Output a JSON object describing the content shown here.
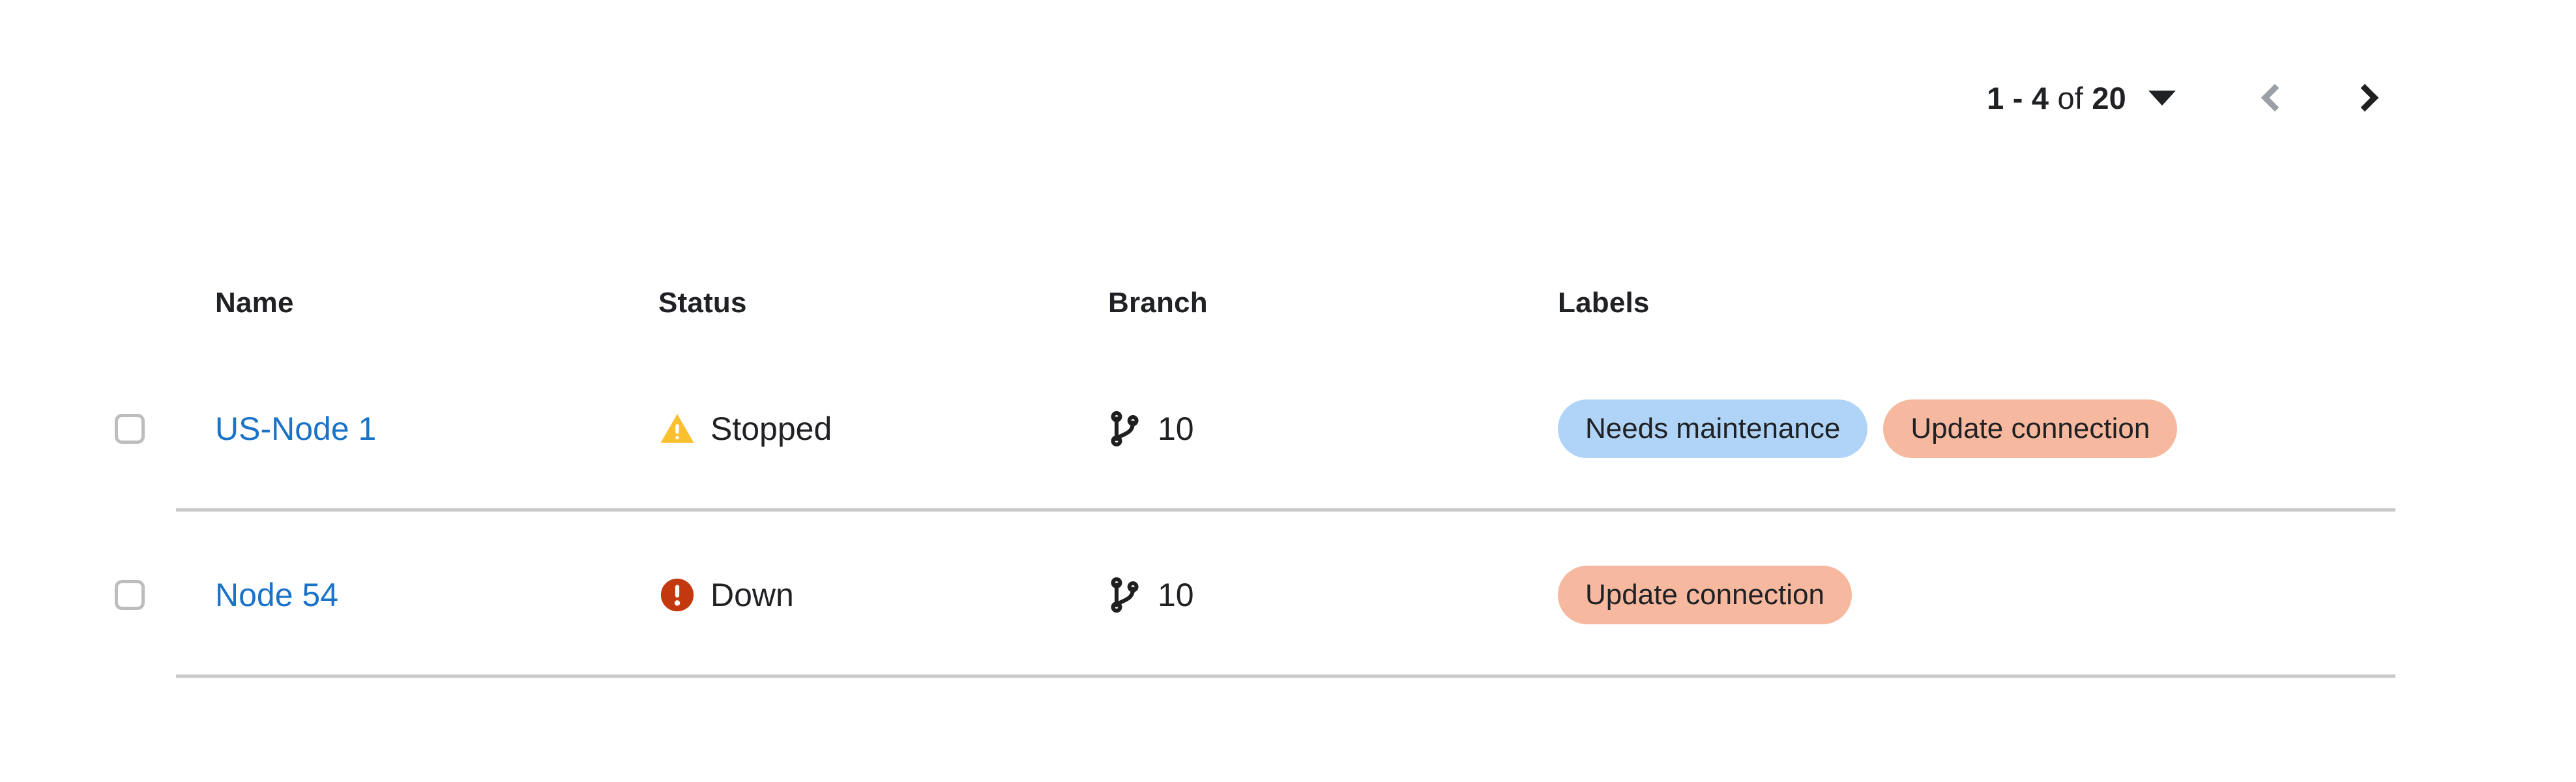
{
  "pagination": {
    "range_start": "1",
    "range_sep": " - ",
    "range_end": "4",
    "of_label": " of ",
    "total": "20",
    "full_label": "1 - 4 of 20",
    "prev_label": "Previous page",
    "next_label": "Next page",
    "prev_enabled": false,
    "next_enabled": true,
    "caret_icon": "chevron-down-icon",
    "prev_icon": "chevron-left-icon",
    "next_icon": "chevron-right-icon"
  },
  "table": {
    "columns": [
      {
        "key": "name",
        "label": "Name"
      },
      {
        "key": "status",
        "label": "Status"
      },
      {
        "key": "branch",
        "label": "Branch"
      },
      {
        "key": "labels",
        "label": "Labels"
      }
    ],
    "rows": [
      {
        "selected": false,
        "name": "US-Node 1",
        "status": {
          "text": "Stopped",
          "icon": "warning-triangle-icon",
          "color": "#FBC02D"
        },
        "branch": {
          "icon": "git-branch-icon",
          "count": "10"
        },
        "labels": [
          {
            "text": "Needs maintenance",
            "color": "#AFD4F8"
          },
          {
            "text": "Update connection",
            "color": "#F6B99F"
          }
        ]
      },
      {
        "selected": false,
        "name": "Node 54",
        "status": {
          "text": "Down",
          "icon": "error-circle-icon",
          "color": "#C3380E"
        },
        "branch": {
          "icon": "git-branch-icon",
          "count": "10"
        },
        "labels": [
          {
            "text": "Update connection",
            "color": "#F6B99F"
          }
        ]
      }
    ]
  },
  "colors": {
    "link": "#1A73C8",
    "text": "#202124",
    "divider": "#C9C9C9",
    "checkbox_border": "#BDBDBD",
    "warning": "#FBC02D",
    "error": "#C3380E",
    "chip_blue": "#AFD4F8",
    "chip_salmon": "#F6B99F",
    "disabled": "#9AA0A6",
    "background": "#FFFFFF"
  }
}
